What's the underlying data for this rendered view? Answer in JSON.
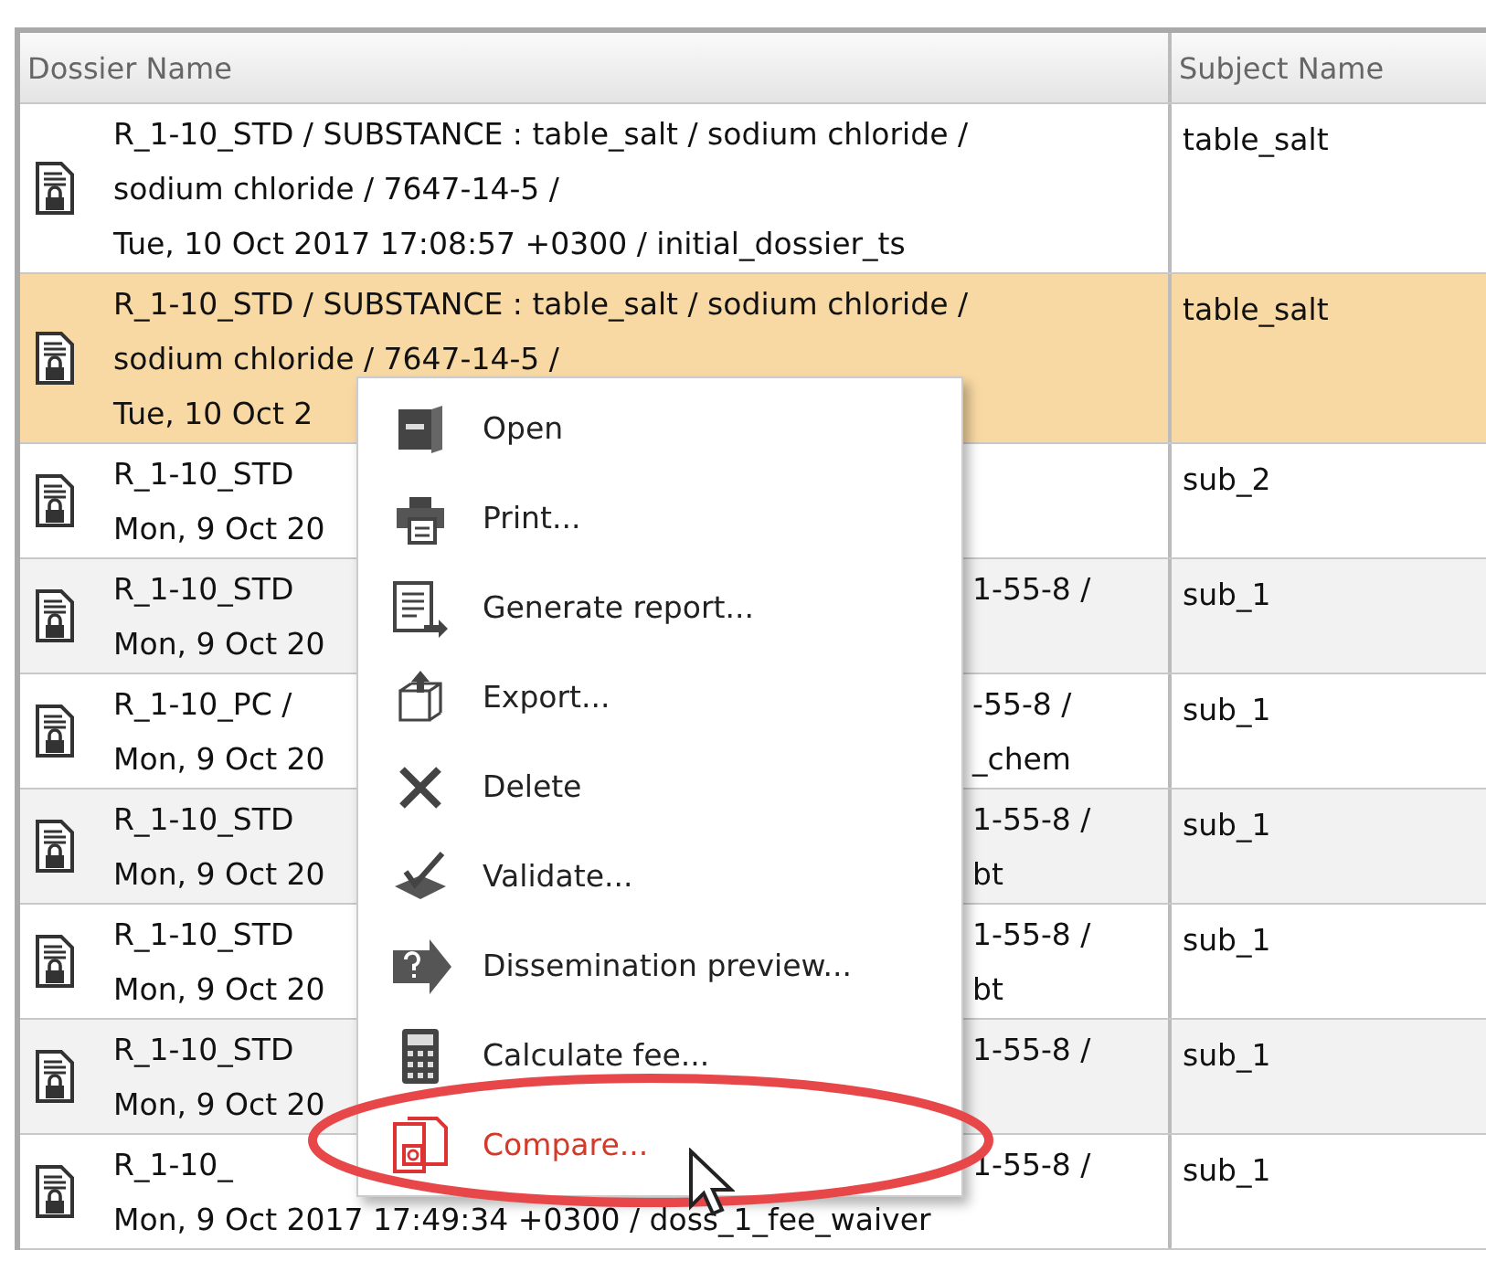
{
  "table": {
    "columns": [
      "Dossier Name",
      "Subject Name"
    ],
    "rows": [
      {
        "selected": false,
        "lines": [
          {
            "left": "R_1-10_STD / SUBSTANCE : table_salt / sodium chloride /"
          },
          {
            "left": "sodium chloride / 7647-14-5 /"
          },
          {
            "left": "Tue, 10 Oct 2017 17:08:57 +0300 / initial_dossier_ts"
          }
        ],
        "subject": "table_salt"
      },
      {
        "selected": true,
        "lines": [
          {
            "left": "R_1-10_STD / SUBSTANCE : table_salt / sodium chloride /"
          },
          {
            "left": "sodium chloride / 7647-14-5 /"
          },
          {
            "left": "Tue, 10 Oct 2"
          }
        ],
        "subject": "table_salt"
      },
      {
        "selected": false,
        "lines": [
          {
            "left": "R_1-10_STD"
          },
          {
            "left": "Mon, 9 Oct 20"
          }
        ],
        "subject": "sub_2"
      },
      {
        "selected": false,
        "lines": [
          {
            "left": "R_1-10_STD",
            "right": "1-55-8 /"
          },
          {
            "left": "Mon, 9 Oct 20"
          }
        ],
        "subject": "sub_1"
      },
      {
        "selected": false,
        "lines": [
          {
            "left": "R_1-10_PC /",
            "right": "-55-8 /"
          },
          {
            "left": "Mon, 9 Oct 20",
            "right": "_chem"
          }
        ],
        "subject": "sub_1"
      },
      {
        "selected": false,
        "lines": [
          {
            "left": "R_1-10_STD",
            "right": "1-55-8 /"
          },
          {
            "left": "Mon, 9 Oct 20",
            "right": "bt"
          }
        ],
        "subject": "sub_1"
      },
      {
        "selected": false,
        "lines": [
          {
            "left": "R_1-10_STD",
            "right": "1-55-8 /"
          },
          {
            "left": "Mon, 9 Oct 20",
            "right": "bt"
          }
        ],
        "subject": "sub_1"
      },
      {
        "selected": false,
        "lines": [
          {
            "left": "R_1-10_STD",
            "right": "1-55-8 /"
          },
          {
            "left": "Mon, 9 Oct 20"
          }
        ],
        "subject": "sub_1"
      },
      {
        "selected": false,
        "lines": [
          {
            "left": "R_1-10_",
            "right": "1-55-8 /"
          },
          {
            "left": "Mon, 9 Oct 2017 17:49:34 +0300 / doss_1_fee_waiver"
          }
        ],
        "subject": "sub_1"
      }
    ]
  },
  "context_menu": {
    "items": [
      {
        "kind": "open",
        "label": "Open",
        "selected": false
      },
      {
        "kind": "print",
        "label": "Print...",
        "selected": false
      },
      {
        "kind": "report",
        "label": "Generate report...",
        "selected": false
      },
      {
        "kind": "export",
        "label": "Export...",
        "selected": false
      },
      {
        "kind": "delete",
        "label": "Delete",
        "selected": false
      },
      {
        "kind": "validate",
        "label": "Validate...",
        "selected": false
      },
      {
        "kind": "preview",
        "label": "Dissemination preview...",
        "selected": false
      },
      {
        "kind": "fee",
        "label": "Calculate fee...",
        "selected": false
      },
      {
        "kind": "compare",
        "label": "Compare...",
        "selected": true
      }
    ]
  }
}
